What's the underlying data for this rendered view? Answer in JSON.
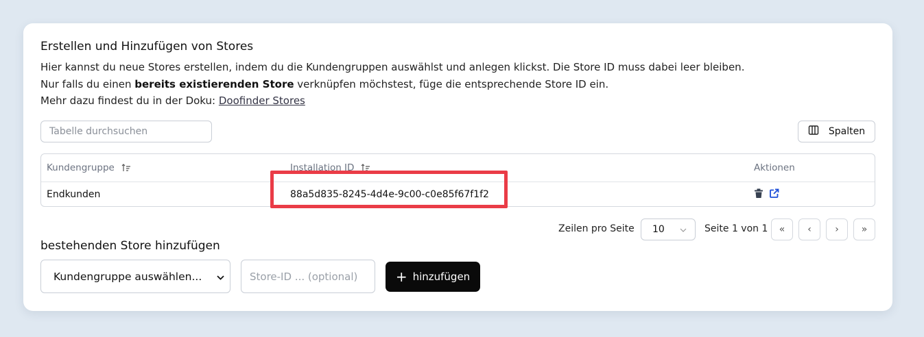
{
  "section": {
    "title": "Erstellen und Hinzufügen von Stores",
    "line1": "Hier kannst du neue Stores erstellen, indem du die Kundengruppen auswählst und anlegen klickst. Die Store ID muss dabei leer bleiben.",
    "line2_before": "Nur falls du einen ",
    "line2_bold": "bereits existierenden Store",
    "line2_after": " verknüpfen möchstest, füge die entsprechende Store ID ein.",
    "line3_before": "Mehr dazu findest du in der Doku: ",
    "line3_link": "Doofinder Stores"
  },
  "toolbar": {
    "search_placeholder": "Tabelle durchsuchen",
    "columns_label": "Spalten",
    "columns_icon": "columns-icon"
  },
  "table": {
    "headers": [
      "Kundengruppe",
      "Installation ID",
      "Aktionen"
    ],
    "rows": [
      {
        "kundengruppe": "Endkunden",
        "installation_id": "88a5d835-8245-4d4e-9c00-c0e85f67f1f2",
        "actions": [
          "trash-icon",
          "external-link-icon"
        ]
      }
    ]
  },
  "pagination": {
    "rows_label": "Zeilen pro Seite",
    "rows_value": "10",
    "page_text": "Seite 1 von 1",
    "first": "«",
    "prev": "‹",
    "next": "›",
    "last": "»"
  },
  "add_store": {
    "title": "bestehenden Store hinzufügen",
    "group_select": "Kundengruppe auswählen...",
    "store_placeholder": "Store-ID ... (optional)",
    "button_label": "hinzufügen",
    "button_icon": "+"
  },
  "colors": {
    "background": "#dfe8f1",
    "highlight": "#ea3c47",
    "action_blue": "#1d4ed8",
    "button_dark": "#0a0a0a"
  }
}
